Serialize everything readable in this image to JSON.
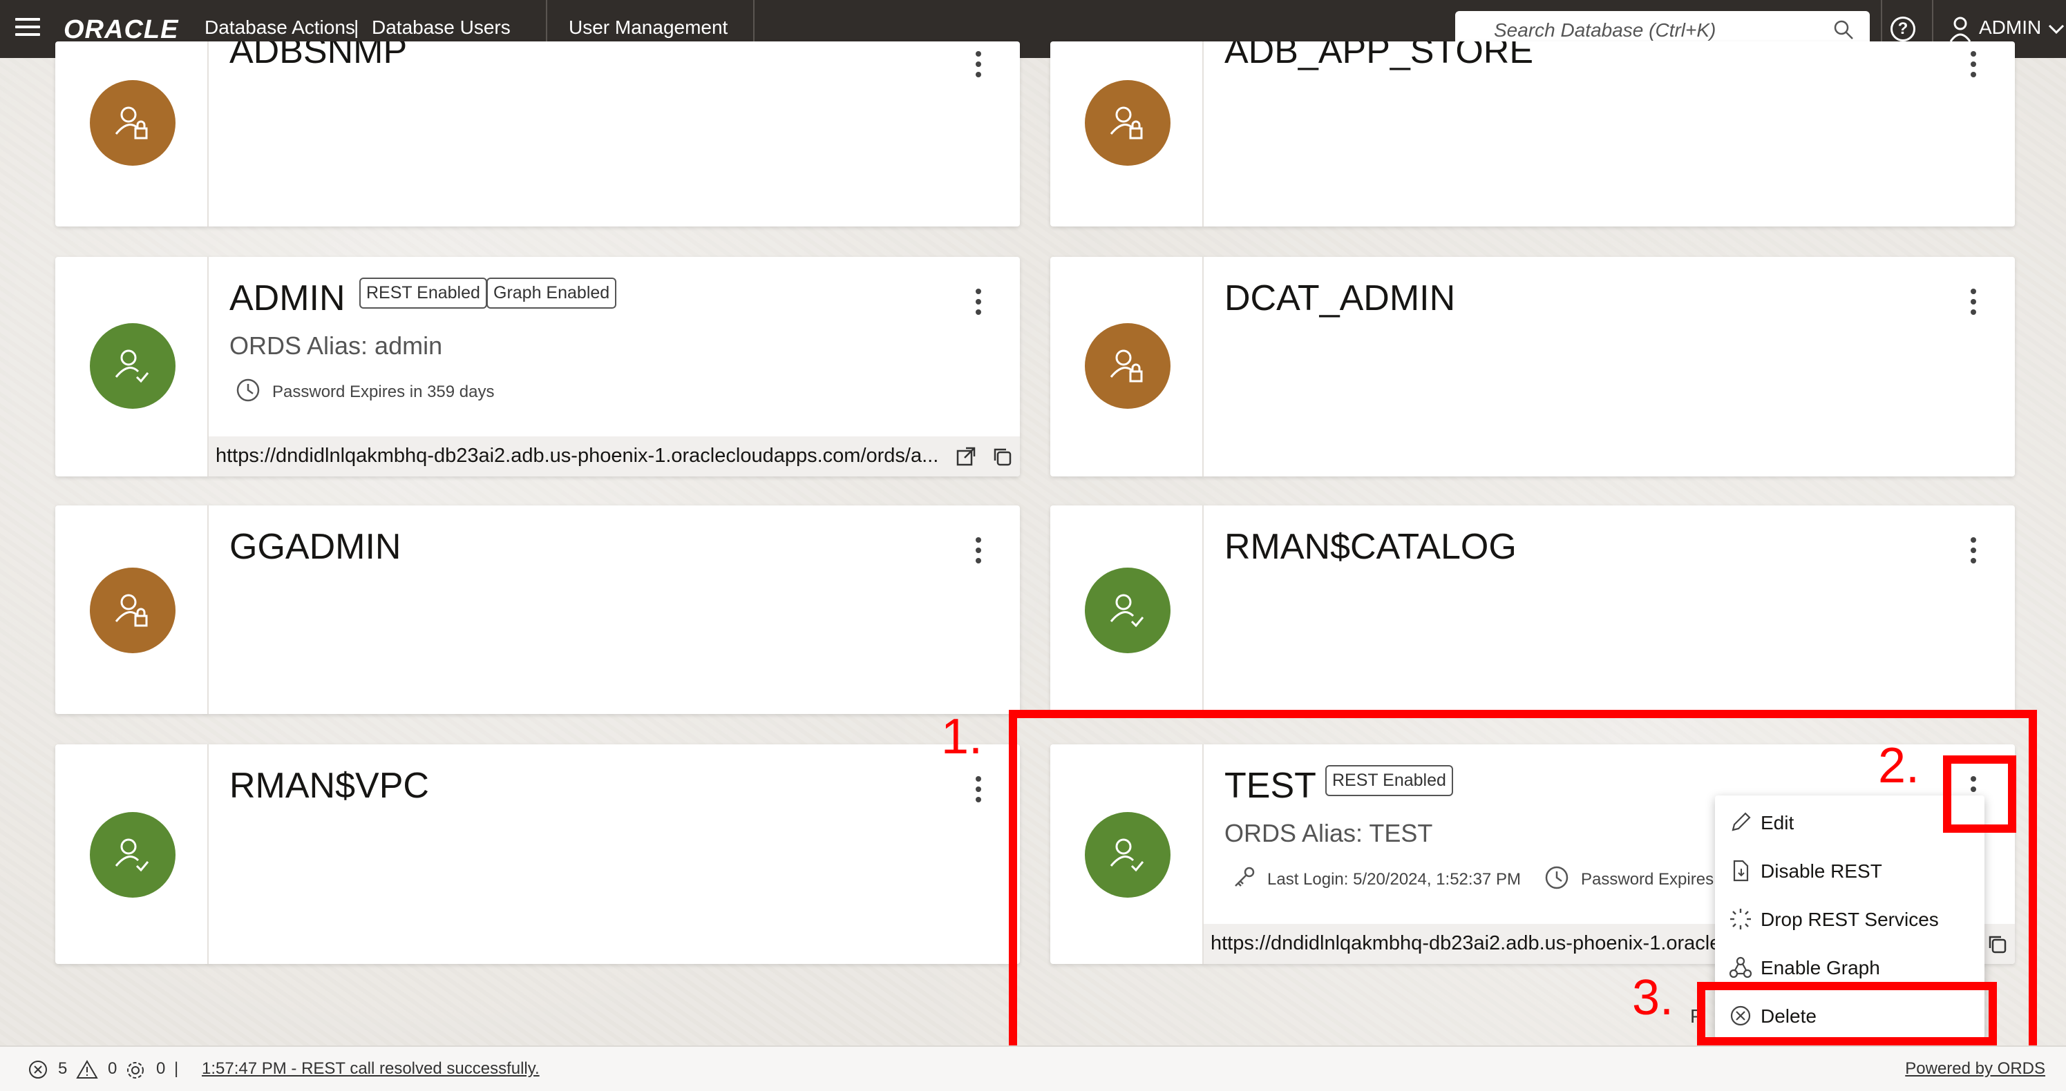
{
  "header": {
    "logo": "ORACLE",
    "app_title": "Database Actions",
    "separator": "|",
    "page_title": "Database Users",
    "nav_tab": "User Management",
    "search_placeholder": "Search Database (Ctrl+K)",
    "help": "?",
    "user": "ADMIN"
  },
  "users": [
    {
      "name": "ADBSNMP",
      "status": "locked"
    },
    {
      "name": "ADB_APP_STORE",
      "status": "locked"
    },
    {
      "name": "ADMIN",
      "status": "open",
      "badges": [
        "REST Enabled",
        "Graph Enabled"
      ],
      "alias": "ORDS Alias: admin",
      "password": "Password Expires in 359 days",
      "url": "https://dndidlnlqakmbhq-db23ai2.adb.us-phoenix-1.oraclecloudapps.com/ords/a..."
    },
    {
      "name": "DCAT_ADMIN",
      "status": "locked"
    },
    {
      "name": "GGADMIN",
      "status": "locked"
    },
    {
      "name": "RMAN$CATALOG",
      "status": "open"
    },
    {
      "name": "RMAN$VPC",
      "status": "open"
    },
    {
      "name": "TEST",
      "status": "open",
      "badges": [
        "REST Enabled"
      ],
      "alias": "ORDS Alias: TEST",
      "last_login": "Last Login: 5/20/2024, 1:52:37 PM",
      "password": "Password Expires",
      "url": "https://dndidlnlqakmbhq-db23ai2.adb.us-phoenix-1.oracle"
    }
  ],
  "context_menu": {
    "items": [
      {
        "label": "Edit",
        "icon": "pencil-icon"
      },
      {
        "label": "Disable REST",
        "icon": "file-rest-icon"
      },
      {
        "label": "Drop REST Services",
        "icon": "spinner-icon"
      },
      {
        "label": "Enable Graph",
        "icon": "graph-icon"
      },
      {
        "label": "Delete",
        "icon": "circle-x-icon"
      }
    ]
  },
  "annotations": {
    "step1": "1.",
    "step2": "2.",
    "step3": "3.",
    "color": "#ff0000"
  },
  "hidden_text": {
    "test_url_p": "P"
  },
  "footer": {
    "errors": "5",
    "warnings": "0",
    "settings": "0",
    "pipe": "|",
    "message": "1:57:47 PM - REST call resolved successfully.",
    "powered": "Powered by ORDS"
  },
  "colors": {
    "header_bg": "#312d2a",
    "avatar_locked": "#a86c2a",
    "avatar_open": "#5a8a32"
  }
}
